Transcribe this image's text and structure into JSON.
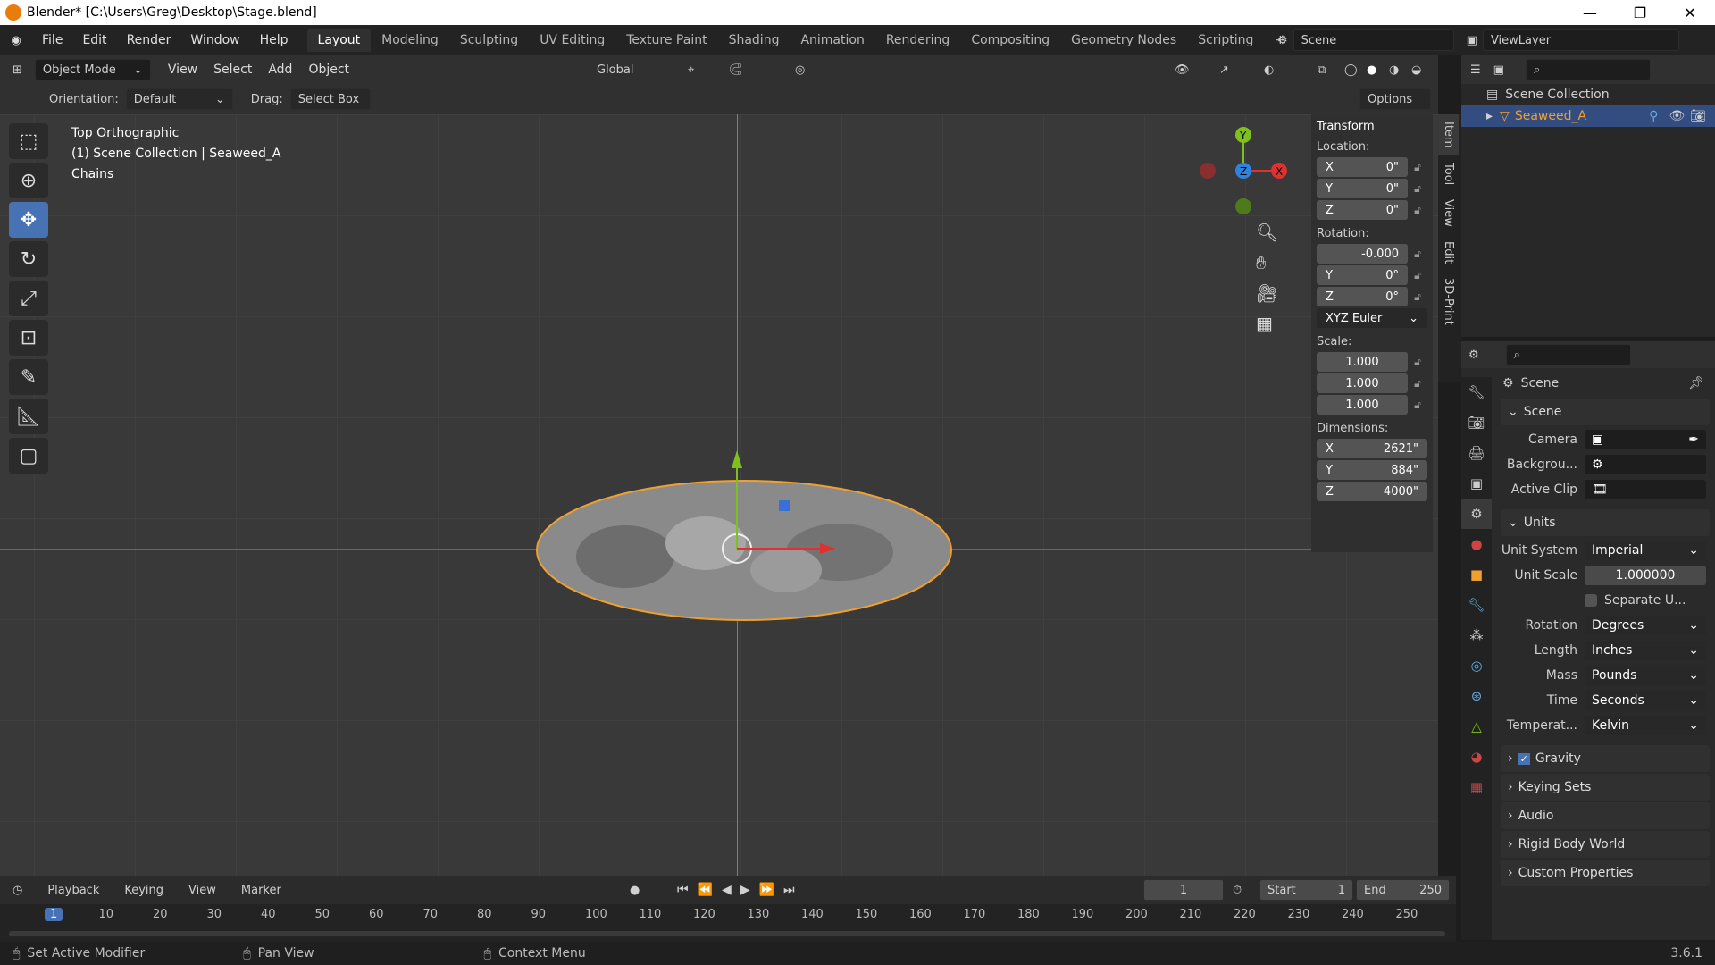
{
  "window": {
    "title": "Blender* [C:\\Users\\Greg\\Desktop\\Stage.blend]"
  },
  "menu": [
    "File",
    "Edit",
    "Render",
    "Window",
    "Help"
  ],
  "workspaces": [
    "Layout",
    "Modeling",
    "Sculpting",
    "UV Editing",
    "Texture Paint",
    "Shading",
    "Animation",
    "Rendering",
    "Compositing",
    "Geometry Nodes",
    "Scripting"
  ],
  "scene_name": "Scene",
  "viewlayer_name": "ViewLayer",
  "header": {
    "mode": "Object Mode",
    "view": "View",
    "select": "Select",
    "add": "Add",
    "object": "Object",
    "transform_orientation": "Global"
  },
  "toolheader": {
    "orientation_label": "Orientation:",
    "orientation_value": "Default",
    "drag_label": "Drag:",
    "drag_value": "Select Box",
    "options": "Options"
  },
  "viewport": {
    "line1": "Top Orthographic",
    "line2": "(1) Scene Collection | Seaweed_A",
    "line3": "Chains"
  },
  "gizmo": {
    "y": "Y",
    "z": "Z",
    "x": "X"
  },
  "npanel": {
    "title": "Transform",
    "location_label": "Location:",
    "location": [
      {
        "axis": "X",
        "value": "0\""
      },
      {
        "axis": "Y",
        "value": "0\""
      },
      {
        "axis": "Z",
        "value": "0\""
      }
    ],
    "rotation_label": "Rotation:",
    "rotation": [
      {
        "axis": "",
        "value": "-0.000"
      },
      {
        "axis": "Y",
        "value": "0°"
      },
      {
        "axis": "Z",
        "value": "0°"
      }
    ],
    "rotation_mode": "XYZ Euler",
    "scale_label": "Scale:",
    "scale": [
      "1.000",
      "1.000",
      "1.000"
    ],
    "dimensions_label": "Dimensions:",
    "dimensions": [
      {
        "axis": "X",
        "value": "2621\""
      },
      {
        "axis": "Y",
        "value": "884\""
      },
      {
        "axis": "Z",
        "value": "4000\""
      }
    ],
    "tabs": [
      "Item",
      "Tool",
      "View",
      "Edit",
      "3D-Print"
    ]
  },
  "outliner": {
    "root": "Scene Collection",
    "item": "Seaweed_A"
  },
  "properties": {
    "context": "Scene",
    "scene_section": "Scene",
    "camera_label": "Camera",
    "background_label": "Backgrou...",
    "active_clip_label": "Active Clip",
    "units_section": "Units",
    "unit_system_label": "Unit System",
    "unit_system": "Imperial",
    "unit_scale_label": "Unit Scale",
    "unit_scale": "1.000000",
    "separate_units": "Separate U...",
    "rotation_label": "Rotation",
    "rotation": "Degrees",
    "length_label": "Length",
    "length": "Inches",
    "mass_label": "Mass",
    "mass": "Pounds",
    "time_label": "Time",
    "time": "Seconds",
    "temperature_label": "Temperat...",
    "temperature": "Kelvin",
    "sections": [
      "Gravity",
      "Keying Sets",
      "Audio",
      "Rigid Body World",
      "Custom Properties"
    ]
  },
  "timeline": {
    "playback": "Playback",
    "keying": "Keying",
    "view": "View",
    "marker": "Marker",
    "current_frame": "1",
    "start_label": "Start",
    "start": "1",
    "end_label": "End",
    "end": "250",
    "ticks": [
      "1",
      "10",
      "20",
      "30",
      "40",
      "50",
      "60",
      "70",
      "80",
      "90",
      "100",
      "110",
      "120",
      "130",
      "140",
      "150",
      "160",
      "170",
      "180",
      "190",
      "200",
      "210",
      "220",
      "230",
      "240",
      "250"
    ]
  },
  "status": {
    "left": "Set Active Modifier",
    "mid": "Pan View",
    "right": "Context Menu",
    "version": "3.6.1"
  }
}
